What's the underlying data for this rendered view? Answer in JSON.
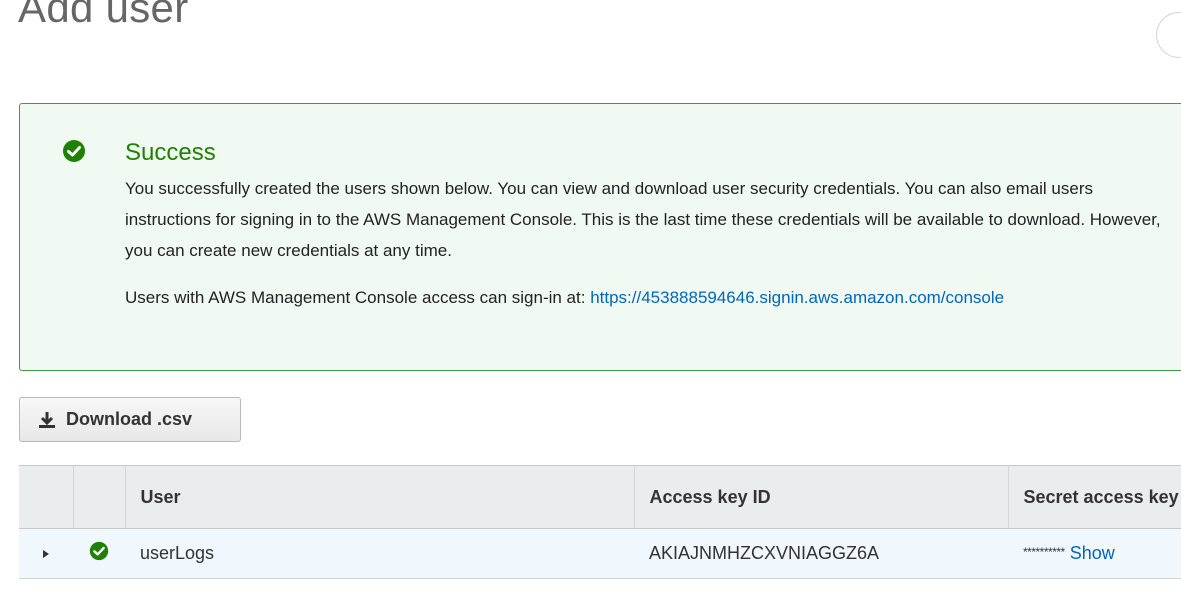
{
  "header": {
    "title": "Add user"
  },
  "success": {
    "title": "Success",
    "message_line1": "You successfully created the users shown below. You can view and download user security credentials. You can also email users",
    "message_line2": "instructions for signing in to the AWS Management Console. This is the last time these credentials will be available to download. However,",
    "message_line3": "you can create new credentials at any time.",
    "signin_prefix": "Users with AWS Management Console access can sign-in at: ",
    "signin_url": "https://453888594646.signin.aws.amazon.com/console"
  },
  "toolbar": {
    "download_label": "Download .csv"
  },
  "table": {
    "columns": [
      "",
      "",
      "User",
      "Access key ID",
      "Secret access key"
    ],
    "rows": [
      {
        "user": "userLogs",
        "access_key_id": "AKIAJNMHZCXVNIAGGZ6A",
        "secret_masked": "**********",
        "show_label": "Show"
      }
    ]
  },
  "colors": {
    "success_green": "#1d8102",
    "link_blue": "#0066c0",
    "success_bg": "#f1faf2"
  }
}
